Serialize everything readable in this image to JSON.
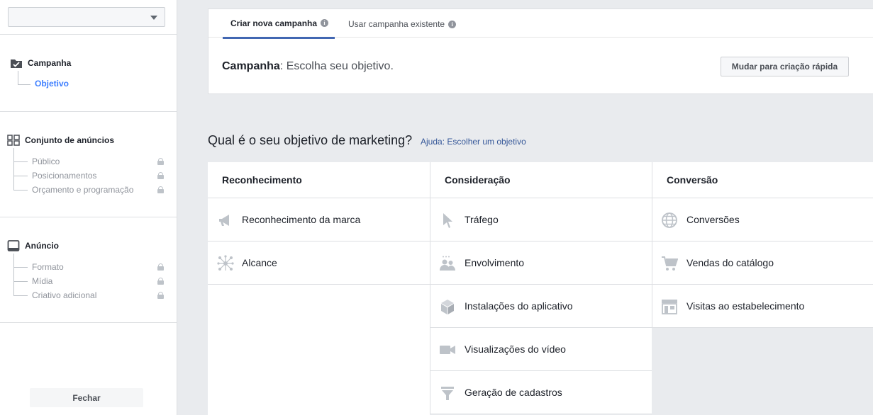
{
  "sidebar": {
    "sections": [
      {
        "title": "Campanha",
        "icon": "campaign-folder-icon",
        "items": [
          {
            "label": "Objetivo",
            "active": true,
            "locked": false
          }
        ]
      },
      {
        "title": "Conjunto de anúncios",
        "icon": "adset-grid-icon",
        "items": [
          {
            "label": "Público",
            "locked": true
          },
          {
            "label": "Posicionamentos",
            "locked": true
          },
          {
            "label": "Orçamento e programação",
            "locked": true
          }
        ]
      },
      {
        "title": "Anúncio",
        "icon": "ad-screen-icon",
        "items": [
          {
            "label": "Formato",
            "locked": true
          },
          {
            "label": "Mídia",
            "locked": true
          },
          {
            "label": "Criativo adicional",
            "locked": true
          }
        ]
      }
    ],
    "close_label": "Fechar"
  },
  "tabs": [
    {
      "label": "Criar nova campanha",
      "active": true
    },
    {
      "label": "Usar campanha existente",
      "active": false
    }
  ],
  "campaign": {
    "prefix": "Campanha",
    "text": ": Escolha seu objetivo."
  },
  "quick_button": "Mudar para criação rápida",
  "objective": {
    "question": "Qual é o seu objetivo de marketing?",
    "help": "Ajuda: Escolher um objetivo"
  },
  "columns": [
    {
      "heading": "Reconhecimento",
      "items": [
        {
          "label": "Reconhecimento da marca",
          "icon": "megaphone-icon"
        },
        {
          "label": "Alcance",
          "icon": "reach-network-icon"
        }
      ]
    },
    {
      "heading": "Consideração",
      "items": [
        {
          "label": "Tráfego",
          "icon": "cursor-icon"
        },
        {
          "label": "Envolvimento",
          "icon": "people-icon"
        },
        {
          "label": "Instalações do aplicativo",
          "icon": "cube-icon"
        },
        {
          "label": "Visualizações do vídeo",
          "icon": "video-camera-icon"
        },
        {
          "label": "Geração de cadastros",
          "icon": "funnel-icon"
        }
      ]
    },
    {
      "heading": "Conversão",
      "items": [
        {
          "label": "Conversões",
          "icon": "globe-icon"
        },
        {
          "label": "Vendas do catálogo",
          "icon": "shopping-cart-icon"
        },
        {
          "label": "Visitas ao estabelecimento",
          "icon": "store-icon"
        }
      ]
    }
  ],
  "colors": {
    "accent": "#4267b2",
    "link": "#365899",
    "active_item": "#4080ff",
    "icon": "#bec3c9"
  }
}
